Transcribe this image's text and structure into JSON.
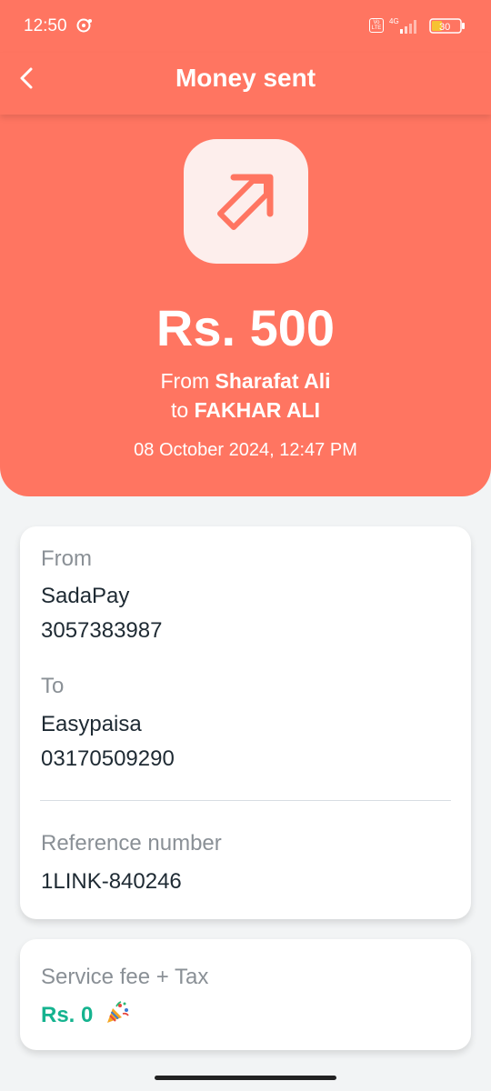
{
  "status_bar": {
    "time": "12:50",
    "volte": "Vo LTE",
    "network": "4G",
    "battery": "30"
  },
  "header": {
    "title": "Money sent"
  },
  "hero": {
    "amount": "Rs. 500",
    "from_prefix": "From",
    "from_name": "Sharafat Ali",
    "to_prefix": "to",
    "to_name": "FAKHAR ALI",
    "datetime": "08 October 2024, 12:47 PM"
  },
  "details": {
    "from_label": "From",
    "from_provider": "SadaPay",
    "from_account": "3057383987",
    "to_label": "To",
    "to_provider": "Easypaisa",
    "to_account": "03170509290",
    "reference_label": "Reference number",
    "reference_value": "1LINK-840246"
  },
  "fee": {
    "label": "Service fee + Tax",
    "value": "Rs. 0"
  },
  "colors": {
    "brand": "#ff7561",
    "fee_green": "#15b38f",
    "background": "#f2f4f5"
  },
  "icons": {
    "back": "chevron-left-icon",
    "sent": "arrow-up-right-icon",
    "party": "party-popper-icon"
  }
}
